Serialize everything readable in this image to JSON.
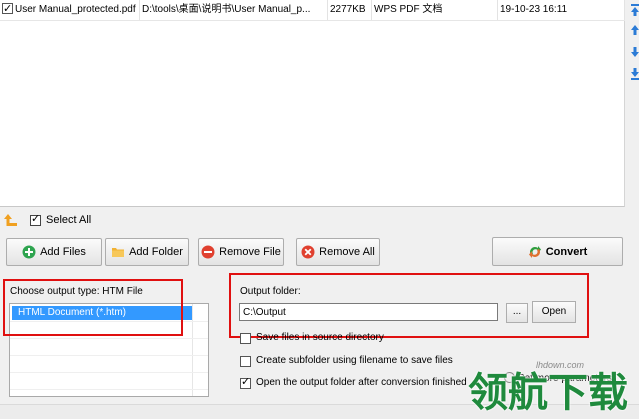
{
  "file_list": {
    "rows": [
      {
        "checked": true,
        "name": "User Manual_protected.pdf",
        "path": "D:\\tools\\桌面\\说明书\\User Manual_p...",
        "size": "2277KB",
        "type": "WPS PDF 文档",
        "date": "19-10-23 16:11"
      }
    ]
  },
  "side_controls": [
    "move-top-icon",
    "move-up-icon",
    "move-down-icon",
    "move-bottom-icon"
  ],
  "select_all": {
    "label": "Select All",
    "checked": true
  },
  "toolbar": {
    "add_files": "Add Files",
    "add_folder": "Add Folder",
    "remove_file": "Remove File",
    "remove_all": "Remove All",
    "convert": "Convert"
  },
  "output_type": {
    "label": "Choose output type:  HTM File",
    "options": [
      "HTML Document (*.htm)"
    ],
    "selected": "HTML Document (*.htm)"
  },
  "output_folder": {
    "label": "Output folder:",
    "value": "C:\\Output",
    "browse_label": "...",
    "open_label": "Open"
  },
  "options": {
    "save_in_source": {
      "label": "Save files in source directory",
      "checked": false
    },
    "create_subfolder": {
      "label": "Create subfolder using filename to save files",
      "checked": false
    },
    "open_after": {
      "label": "Open the output folder after conversion finished",
      "checked": true
    }
  },
  "more_params_label": "Set more parameters",
  "watermark": {
    "url": "lhdown.com",
    "text": "领航下载"
  },
  "colors": {
    "selection": "#3399ff",
    "highlight_box": "#e01010",
    "convert_icon": "#2e9e3e",
    "watermark": "#1f8a3d"
  }
}
